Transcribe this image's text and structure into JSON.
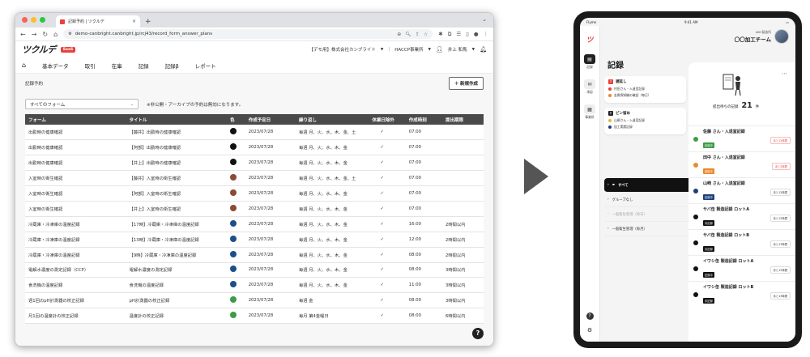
{
  "browser": {
    "tab_title": "記録予約 | ツクルデ",
    "url": "demo-canbright.canbright.jp/rcj43/record_form_answer_plans"
  },
  "app": {
    "logo": "ツクルデ",
    "saas_badge": "SaaS",
    "company": "【デモ用】株式会社カンブライト",
    "site": "HACCP事業所",
    "user": "井上 和馬",
    "menu": [
      "基本データ",
      "取引",
      "在庫",
      "記録",
      "記録β",
      "レポート"
    ]
  },
  "page": {
    "title": "記録予約",
    "new_button": "新規作成",
    "filter_value": "すべてのフォーム",
    "note": "※非公開・アーカイブの予約は無効になります。"
  },
  "table": {
    "headers": [
      "フォーム",
      "タイトル",
      "色",
      "作成予定日",
      "繰り返し",
      "休業日除外",
      "作成時刻",
      "提出期限"
    ],
    "rows": [
      {
        "form": "出勤時の健康確認",
        "title": "【藤井】出勤時の健康確認",
        "color": "#111111",
        "date": "2023/07/28",
        "repeat": "毎週 月、火、水、木、金、土",
        "exclude": "✓",
        "time": "07:00",
        "deadline": ""
      },
      {
        "form": "出勤時の健康確認",
        "title": "【阿部】出勤時の健康確認",
        "color": "#111111",
        "date": "2023/07/28",
        "repeat": "毎週 月、火、水、木、金",
        "exclude": "✓",
        "time": "07:00",
        "deadline": ""
      },
      {
        "form": "出勤時の健康確認",
        "title": "【井上】出勤時の健康確認",
        "color": "#111111",
        "date": "2023/07/28",
        "repeat": "毎週 月、火、水、木、金",
        "exclude": "✓",
        "time": "07:00",
        "deadline": ""
      },
      {
        "form": "入室時の衛生確認",
        "title": "【藤井】入室時の衛生確認",
        "color": "#8a4b32",
        "date": "2023/07/28",
        "repeat": "毎週 月、火、水、木、金、土",
        "exclude": "✓",
        "time": "07:00",
        "deadline": ""
      },
      {
        "form": "入室時の衛生確認",
        "title": "【阿部】入室時の衛生確認",
        "color": "#8a4b32",
        "date": "2023/07/28",
        "repeat": "毎週 月、火、水、木、金",
        "exclude": "✓",
        "time": "07:00",
        "deadline": ""
      },
      {
        "form": "入室時の衛生確認",
        "title": "【井上】入室時の衛生確認",
        "color": "#8a4b32",
        "date": "2023/07/28",
        "repeat": "毎週 月、火、水、木、金",
        "exclude": "✓",
        "time": "07:00",
        "deadline": ""
      },
      {
        "form": "冷蔵庫・冷凍庫の温度記録",
        "title": "【17時】冷蔵庫・冷凍庫の温度記録",
        "color": "#1d4e89",
        "date": "2023/07/28",
        "repeat": "毎週 月、火、水、木、金",
        "exclude": "✓",
        "time": "16:00",
        "deadline": "2時間以内"
      },
      {
        "form": "冷蔵庫・冷凍庫の温度記録",
        "title": "【13時】冷蔵庫・冷凍庫の温度記録",
        "color": "#1d4e89",
        "date": "2023/07/28",
        "repeat": "毎週 月、火、水、木、金",
        "exclude": "✓",
        "time": "12:00",
        "deadline": "2時間以内"
      },
      {
        "form": "冷蔵庫・冷凍庫の温度記録",
        "title": "【9時】冷蔵庫・冷凍庫の温度記録",
        "color": "#1d4e89",
        "date": "2023/07/28",
        "repeat": "毎週 月、火、水、木、金",
        "exclude": "✓",
        "time": "08:00",
        "deadline": "2時間以内"
      },
      {
        "form": "電解水濃度の測定記録（CCP）",
        "title": "電解水濃度の測定記録",
        "color": "#1d4e89",
        "date": "2023/07/28",
        "repeat": "毎週 月、火、水、木、金",
        "exclude": "✓",
        "time": "08:00",
        "deadline": "3時間以内"
      },
      {
        "form": "食洗機の温度記録",
        "title": "食洗機の温度記録",
        "color": "#1d4e89",
        "date": "2023/07/28",
        "repeat": "毎週 月、火、水、木、金",
        "exclude": "✓",
        "time": "11:00",
        "deadline": "3時間以内"
      },
      {
        "form": "週1回のpH計測器の校正記録",
        "title": "pH計測器の校正記録",
        "color": "#3f9b45",
        "date": "2023/07/28",
        "repeat": "毎週 金",
        "exclude": "✓",
        "time": "08:00",
        "deadline": "3時間以内"
      },
      {
        "form": "月1回の温度計の校正記録",
        "title": "温度計の校正記録",
        "color": "#3f9b45",
        "date": "2023/07/28",
        "repeat": "毎月 第4金曜日",
        "exclude": "✓",
        "time": "08:00",
        "deadline": "6時間以内"
      }
    ]
  },
  "tablet": {
    "carrier": "Flyme",
    "time": "9:41 AM",
    "org_small": "ABC製造所",
    "org_team": "〇〇加工チーム",
    "nav": [
      "記録",
      "承認",
      "事業所"
    ],
    "heading": "記録",
    "overdue_title": "遅延し",
    "overdue_items": [
      {
        "text": "村田さん・入退室記録",
        "color": "#e8423b"
      },
      {
        "text": "金属探知機の確認（毎日）",
        "color": "#e88a2e"
      }
    ],
    "pinned_title": "ピン留め",
    "pinned_items": [
      {
        "text": "山崎さん・入退室記録",
        "color": "#e8b82e"
      },
      {
        "text": "加工実績記録",
        "color": "#1d3e7a"
      }
    ],
    "groups": [
      "すべて",
      "グループなし",
      "一般衛生管理（毎日）",
      "一般衛生管理（毎月）"
    ],
    "count_label": "提出待ちの記録",
    "count": "21",
    "count_unit": "件",
    "records": [
      {
        "name": "佐藤 さん・入退室記録",
        "color": "#3f9b45",
        "tag": "記録中",
        "tag_color": "#3f9b45",
        "rem": "あと12時間",
        "rem_color": "#e8423b"
      },
      {
        "name": "田中 さん・入退室記録",
        "color": "#e88a2e",
        "tag": "遅延中",
        "tag_color": "#e88a2e",
        "rem": "あと2時間",
        "rem_color": "#e8423b"
      },
      {
        "name": "山崎 さん・入退室記録",
        "color": "#1d3e7a",
        "tag": "記録中",
        "tag_color": "#1d3e7a",
        "rem": "あと12時間",
        "rem_color": "#333"
      },
      {
        "name": "サバ缶 製造記録 ロットA",
        "color": "#111111",
        "tag": "未記録",
        "tag_color": "#111111",
        "rem": "あと12時間",
        "rem_color": "#333"
      },
      {
        "name": "サバ缶 製造記録 ロットB",
        "color": "#111111",
        "tag": "未記録",
        "tag_color": "#111111",
        "rem": "あと13時間",
        "rem_color": "#333"
      },
      {
        "name": "イワシ缶 製造記録 ロットA",
        "color": "#111111",
        "tag": "記録中",
        "tag_color": "#111111",
        "rem": "あと12時間",
        "rem_color": "#333"
      },
      {
        "name": "イワシ缶 製造記録 ロットB",
        "color": "#111111",
        "tag": "未記録",
        "tag_color": "#111111",
        "rem": "あと13時間",
        "rem_color": "#333"
      }
    ]
  }
}
